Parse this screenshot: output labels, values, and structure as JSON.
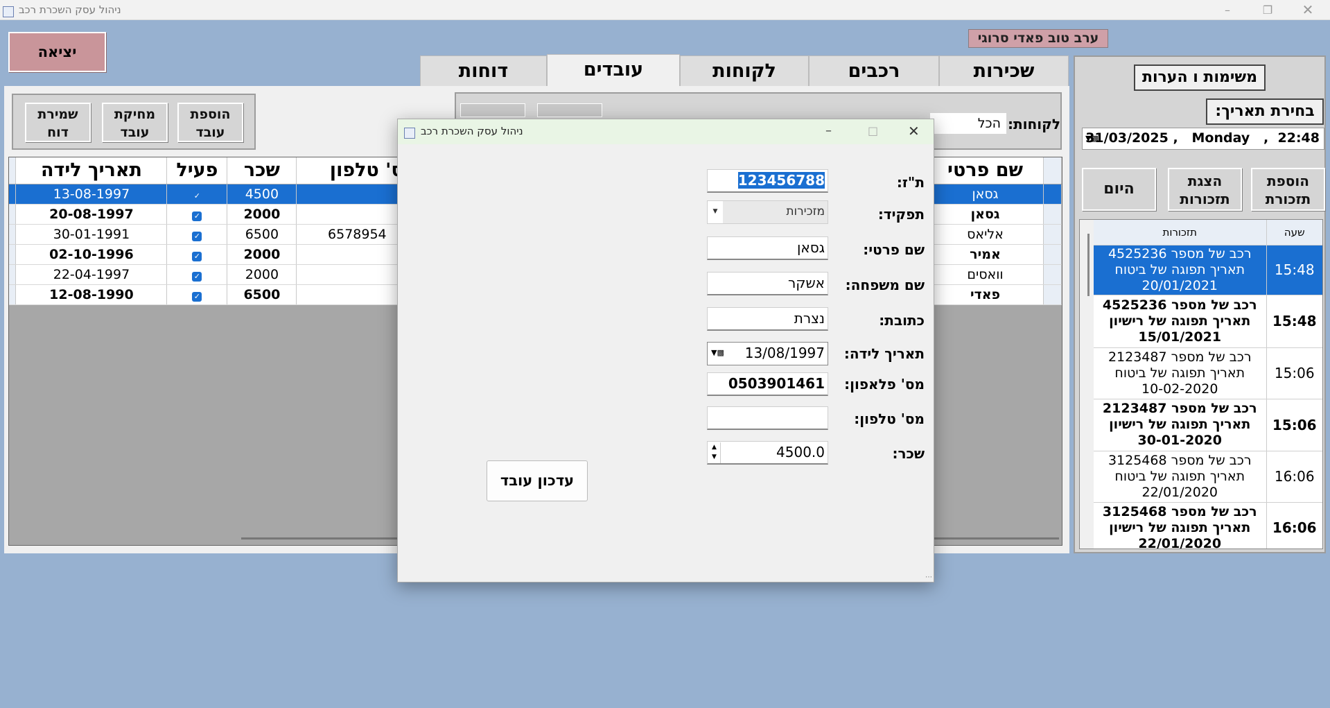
{
  "window_title": "ניהול עסק השכרת רכב",
  "greeting": "ערב טוב פאדי סרוגי",
  "exit_label": "יציאה",
  "tabs": [
    "שכירות",
    "רכבים",
    "לקוחות",
    "עובדים",
    "דוחות"
  ],
  "actions": {
    "add": "הוספת עובד",
    "del": "מחיקת עובד",
    "save": "שמירת דוח"
  },
  "filter": {
    "label": "לקוחות:",
    "value": "הכל"
  },
  "grid": {
    "headers": {
      "first": "שם פרטי",
      "phone": "מס' טלפון",
      "salary": "שכר",
      "active": "פעיל",
      "birth": "תאריך לידה"
    },
    "rows": [
      {
        "first": "גסאן",
        "phone": "",
        "salary": "4500",
        "birth": "13-08-1997"
      },
      {
        "first": "גסאן",
        "phone": "",
        "salary": "2000",
        "birth": "20-08-1997"
      },
      {
        "first": "אליאס",
        "phone": "6578954",
        "salary": "6500",
        "birth": "30-01-1991"
      },
      {
        "first": "אמיר",
        "phone": "",
        "salary": "2000",
        "birth": "02-10-1996"
      },
      {
        "first": "וואסים",
        "phone": "",
        "salary": "2000",
        "birth": "22-04-1997"
      },
      {
        "first": "פאדי",
        "phone": "",
        "salary": "6500",
        "birth": "12-08-1990"
      }
    ]
  },
  "right": {
    "notes_title": "משימות ו הערות",
    "date_title": "בחירת תאריך:",
    "datetime": "31/03/2025 ,   Monday   ,  22:48",
    "btn_add": "הוספת תזכורת",
    "btn_show": "הצגת תזכורות",
    "btn_today": "היום",
    "col_time": "שעה",
    "col_rem": "תזכורות",
    "rows": [
      {
        "time": "15:48",
        "l1": "רכב של מספר 4525236",
        "l2": "תאריך תפוגה של ביטוח",
        "l3": "20/01/2021"
      },
      {
        "time": "15:48",
        "l1": "רכב של מספר 4525236",
        "l2": "תאריך תפוגה של רישיון",
        "l3": "15/01/2021"
      },
      {
        "time": "15:06",
        "l1": "רכב של מספר 2123487",
        "l2": "תאריך תפוגה של ביטוח",
        "l3": "10-02-2020"
      },
      {
        "time": "15:06",
        "l1": "רכב של מספר 2123487",
        "l2": "תאריך תפוגה של רישיון",
        "l3": "30-01-2020"
      },
      {
        "time": "16:06",
        "l1": "רכב של מספר 3125468",
        "l2": "תאריך תפוגה של ביטוח",
        "l3": "22/01/2020"
      },
      {
        "time": "16:06",
        "l1": "רכב של מספר 3125468",
        "l2": "תאריך תפוגה של רישיון",
        "l3": "22/01/2020"
      }
    ]
  },
  "dialog": {
    "title": "ניהול עסק השכרת רכב",
    "id_label": "ת\"ז:",
    "id_value": "123456788",
    "role_label": "תפקיד:",
    "role_value": "מזכירות",
    "first_label": "שם פרטי:",
    "first_value": "גסאן",
    "last_label": "שם משפחה:",
    "last_value": "אשקר",
    "addr_label": "כתובת:",
    "addr_value": "נצרת",
    "birth_label": "תאריך לידה:",
    "birth_value": "13/08/1997",
    "mobile_label": "מס' פלאפון:",
    "mobile_value": "0503901461",
    "phone_label": "מס' טלפון:",
    "phone_value": "",
    "salary_label": "שכר:",
    "salary_value": "4500.0",
    "update_label": "עדכון עובד"
  }
}
